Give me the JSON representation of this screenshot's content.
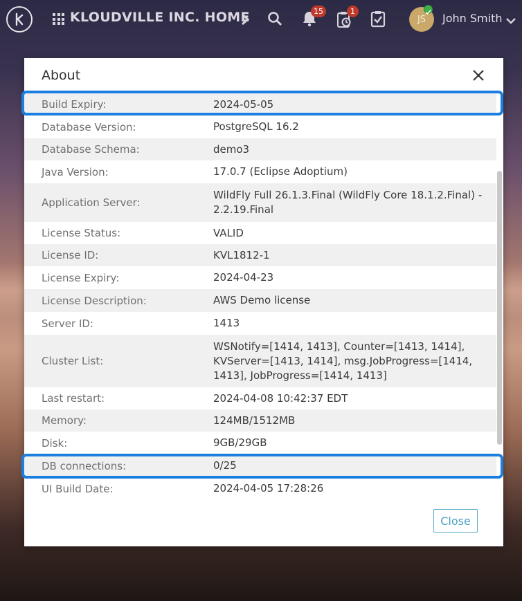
{
  "header": {
    "home_title": "KLOUDVILLE INC. HOME",
    "notifications_count": "15",
    "timers_count": "1",
    "user_initials": "JS",
    "user_name": "John Smith"
  },
  "dialog": {
    "title": "About",
    "close_label": "Close",
    "rows": [
      {
        "label": "Build Expiry:",
        "value": "2024-05-05"
      },
      {
        "label": "Database Version:",
        "value": "PostgreSQL 16.2"
      },
      {
        "label": "Database Schema:",
        "value": "demo3"
      },
      {
        "label": "Java Version:",
        "value": "17.0.7 (Eclipse Adoptium)"
      },
      {
        "label": "Application Server:",
        "value": "WildFly Full 26.1.3.Final (WildFly Core 18.1.2.Final) - 2.2.19.Final"
      },
      {
        "label": "License Status:",
        "value": "VALID"
      },
      {
        "label": "License ID:",
        "value": "KVL1812-1"
      },
      {
        "label": "License Expiry:",
        "value": "2024-04-23"
      },
      {
        "label": "License Description:",
        "value": "AWS Demo license"
      },
      {
        "label": "Server ID:",
        "value": "1413"
      },
      {
        "label": "Cluster List:",
        "value": "WSNotify=[1414, 1413], Counter=[1413, 1414], KVServer=[1413, 1414], msg.JobProgress=[1414, 1413], JobProgress=[1414, 1413]"
      },
      {
        "label": "Last restart:",
        "value": "2024-04-08 10:42:37 EDT"
      },
      {
        "label": "Memory:",
        "value": "124MB/1512MB"
      },
      {
        "label": "Disk:",
        "value": "9GB/29GB"
      },
      {
        "label": "DB connections:",
        "value": "0/25"
      },
      {
        "label": "UI Build Date:",
        "value": "2024-04-05 17:28:26"
      }
    ]
  },
  "colors": {
    "highlight": "#1a7fe0",
    "badge": "#c0392b",
    "close_button": "#4a9fc4"
  }
}
